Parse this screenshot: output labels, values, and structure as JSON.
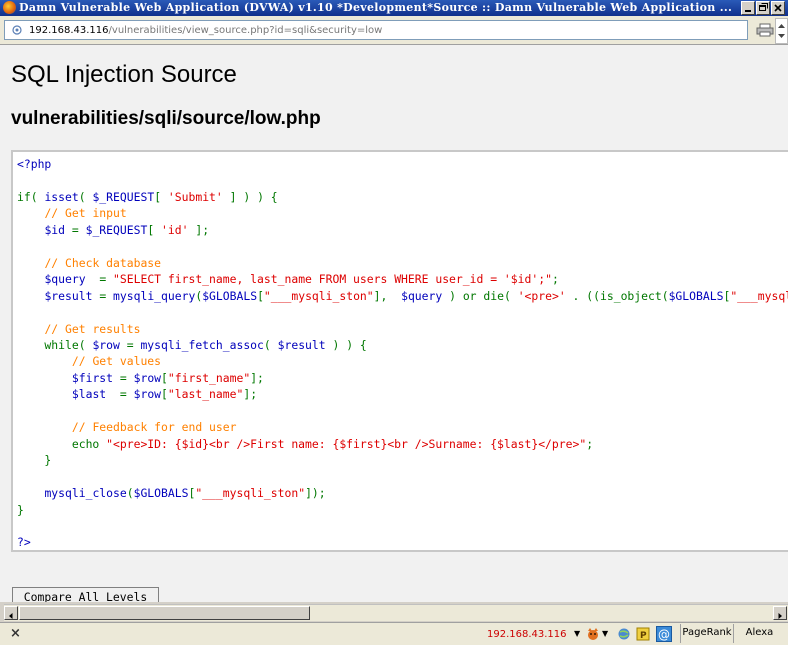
{
  "window": {
    "title": "Damn Vulnerable Web Application (DVWA) v1.10 *Development*Source :: Damn Vulnerable Web Application ..."
  },
  "address_bar": {
    "host": "192.168.43.116",
    "path": "/vulnerabilities/view_source.php?id=sqli&security=low"
  },
  "page": {
    "title": "SQL Injection Source",
    "file_path": "vulnerabilities/sqli/source/low.php"
  },
  "code": {
    "lines": [
      [
        [
          "d",
          "<?php"
        ]
      ],
      [],
      [
        [
          "k",
          "if( "
        ],
        [
          "d",
          "isset"
        ],
        [
          "k",
          "( "
        ],
        [
          "d",
          "$_REQUEST"
        ],
        [
          "k",
          "[ "
        ],
        [
          "s",
          "'Submit'"
        ],
        [
          "k",
          " ] ) ) {"
        ]
      ],
      [
        [
          "k",
          "    "
        ],
        [
          "c",
          "// Get input"
        ]
      ],
      [
        [
          "k",
          "    "
        ],
        [
          "d",
          "$id "
        ],
        [
          "k",
          "= "
        ],
        [
          "d",
          "$_REQUEST"
        ],
        [
          "k",
          "[ "
        ],
        [
          "s",
          "'id'"
        ],
        [
          "k",
          " ];"
        ]
      ],
      [],
      [
        [
          "k",
          "    "
        ],
        [
          "c",
          "// Check database"
        ]
      ],
      [
        [
          "k",
          "    "
        ],
        [
          "d",
          "$query  "
        ],
        [
          "k",
          "= "
        ],
        [
          "s",
          "\"SELECT first_name, last_name FROM users WHERE user_id = '$id';\""
        ],
        [
          "k",
          ";"
        ]
      ],
      [
        [
          "k",
          "    "
        ],
        [
          "d",
          "$result "
        ],
        [
          "k",
          "= "
        ],
        [
          "d",
          "mysqli_query"
        ],
        [
          "k",
          "("
        ],
        [
          "d",
          "$GLOBALS"
        ],
        [
          "k",
          "["
        ],
        [
          "s",
          "\"___mysqli_ston\""
        ],
        [
          "k",
          "],  "
        ],
        [
          "d",
          "$query "
        ],
        [
          "k",
          ") or die( "
        ],
        [
          "s",
          "'<pre>'"
        ],
        [
          "k",
          " . ((is_object("
        ],
        [
          "d",
          "$GLOBALS"
        ],
        [
          "k",
          "["
        ],
        [
          "s",
          "\"___mysqli_ston\""
        ],
        [
          "k",
          "]))"
        ]
      ],
      [],
      [
        [
          "k",
          "    "
        ],
        [
          "c",
          "// Get results"
        ]
      ],
      [
        [
          "k",
          "    while( "
        ],
        [
          "d",
          "$row "
        ],
        [
          "k",
          "= "
        ],
        [
          "d",
          "mysqli_fetch_assoc"
        ],
        [
          "k",
          "( "
        ],
        [
          "d",
          "$result "
        ],
        [
          "k",
          ") ) {"
        ]
      ],
      [
        [
          "k",
          "        "
        ],
        [
          "c",
          "// Get values"
        ]
      ],
      [
        [
          "k",
          "        "
        ],
        [
          "d",
          "$first "
        ],
        [
          "k",
          "= "
        ],
        [
          "d",
          "$row"
        ],
        [
          "k",
          "["
        ],
        [
          "s",
          "\"first_name\""
        ],
        [
          "k",
          "];"
        ]
      ],
      [
        [
          "k",
          "        "
        ],
        [
          "d",
          "$last  "
        ],
        [
          "k",
          "= "
        ],
        [
          "d",
          "$row"
        ],
        [
          "k",
          "["
        ],
        [
          "s",
          "\"last_name\""
        ],
        [
          "k",
          "];"
        ]
      ],
      [],
      [
        [
          "k",
          "        "
        ],
        [
          "c",
          "// Feedback for end user"
        ]
      ],
      [
        [
          "k",
          "        echo "
        ],
        [
          "s",
          "\"<pre>ID: {$id}<br />First name: {$first}<br />Surname: {$last}</pre>\""
        ],
        [
          "k",
          ";"
        ]
      ],
      [
        [
          "k",
          "    }"
        ]
      ],
      [],
      [
        [
          "k",
          "    "
        ],
        [
          "d",
          "mysqli_close"
        ],
        [
          "k",
          "("
        ],
        [
          "d",
          "$GLOBALS"
        ],
        [
          "k",
          "["
        ],
        [
          "s",
          "\"___mysqli_ston\""
        ],
        [
          "k",
          "]);"
        ]
      ],
      [
        [
          "k",
          "}"
        ]
      ],
      [],
      [
        [
          "d",
          "?>"
        ]
      ]
    ]
  },
  "buttons": {
    "compare_all_levels": "Compare All Levels"
  },
  "status_bar": {
    "close_glyph": "×",
    "ip": "192.168.43.116",
    "pagerank_label": "PageRank",
    "alexa_label": "Alexa"
  },
  "colors": {
    "default": "#0000bb",
    "keyword": "#007700",
    "string": "#dd0000",
    "comment": "#ff8000",
    "titlebar": "#10308c"
  }
}
